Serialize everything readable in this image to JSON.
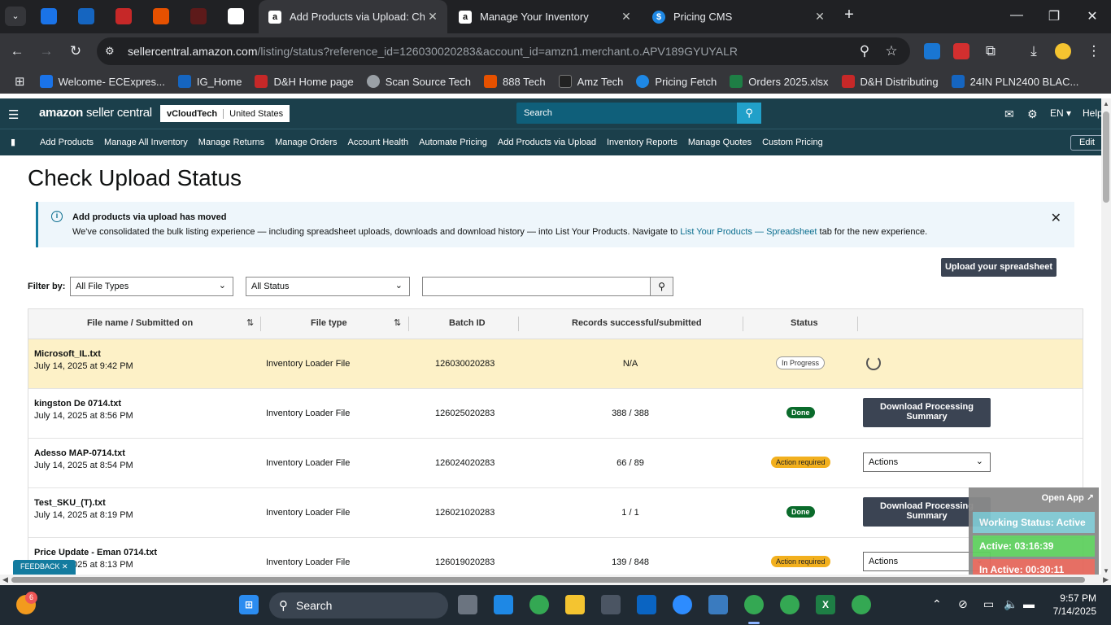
{
  "browser": {
    "tabs": [
      {
        "title": "Add Products via Upload: Check",
        "active": true
      },
      {
        "title": "Manage Your Inventory",
        "active": false
      },
      {
        "title": "Pricing CMS",
        "active": false
      }
    ],
    "url_host": "sellercentral.amazon.com",
    "url_path": "/listing/status?reference_id=126030020283&account_id=amzn1.merchant.o.APV189GYUYALR",
    "bookmarks": [
      {
        "label": "Welcome- ECExpres...",
        "color": "#1a73e8"
      },
      {
        "label": "IG_Home",
        "color": "#1565c0"
      },
      {
        "label": "D&H Home page",
        "color": "#c62828"
      },
      {
        "label": "Scan Source Tech",
        "color": "#9aa0a6"
      },
      {
        "label": "888 Tech",
        "color": "#e65100"
      },
      {
        "label": "Amz Tech",
        "color": "#222222"
      },
      {
        "label": "Pricing Fetch",
        "color": "#1e88e5"
      },
      {
        "label": "Orders 2025.xlsx",
        "color": "#1e7e45"
      },
      {
        "label": "D&H Distributing",
        "color": "#c62828"
      },
      {
        "label": "24IN PLN2400 BLAC...",
        "color": "#1565c0"
      }
    ]
  },
  "seller": {
    "logo_main": "amazon",
    "logo_sub": "seller central",
    "store": "vCloudTech",
    "marketplace": "United States",
    "search_placeholder": "Search",
    "lang": "EN",
    "help": "Help",
    "nav": [
      "Add Products",
      "Manage All Inventory",
      "Manage Returns",
      "Manage Orders",
      "Account Health",
      "Automate Pricing",
      "Add Products via Upload",
      "Inventory Reports",
      "Manage Quotes",
      "Custom Pricing"
    ],
    "edit": "Edit"
  },
  "page": {
    "title": "Check Upload Status",
    "banner_title": "Add products via upload has moved",
    "banner_text_1": "We've consolidated the bulk listing experience — including spreadsheet uploads, downloads and download history — into List Your Products. Navigate to ",
    "banner_link": "List Your Products — Spreadsheet",
    "banner_text_2": " tab for the new experience.",
    "upload_button": "Upload your spreadsheet",
    "filter_label": "Filter by:",
    "filter_type": "All File Types",
    "filter_status": "All Status",
    "search_value": ""
  },
  "table": {
    "headers": [
      "File name / Submitted on",
      "File type",
      "Batch ID",
      "Records successful/submitted",
      "Status"
    ],
    "rows": [
      {
        "name": "Microsoft_IL.txt",
        "date": "July 14, 2025 at 9:42 PM",
        "type": "Inventory Loader File",
        "batch": "126030020283",
        "records": "N/A",
        "status": "In Progress",
        "kind": "progress"
      },
      {
        "name": "kingston De 0714.txt",
        "date": "July 14, 2025 at 8:56 PM",
        "type": "Inventory Loader File",
        "batch": "126025020283",
        "records": "388 / 388",
        "status": "Done",
        "kind": "done"
      },
      {
        "name": "Adesso MAP-0714.txt",
        "date": "July 14, 2025 at 8:54 PM",
        "type": "Inventory Loader File",
        "batch": "126024020283",
        "records": "66 / 89",
        "status": "Action required",
        "kind": "action"
      },
      {
        "name": "Test_SKU_(T).txt",
        "date": "July 14, 2025 at 8:19 PM",
        "type": "Inventory Loader File",
        "batch": "126021020283",
        "records": "1 / 1",
        "status": "Done",
        "kind": "done"
      },
      {
        "name": "Price Update - Eman 0714.txt",
        "date": "July 14, 2025 at 8:13 PM",
        "type": "Inventory Loader File",
        "batch": "126019020283",
        "records": "139 / 848",
        "status": "Action required",
        "kind": "action"
      }
    ],
    "download_label": "Download Processing Summary",
    "actions_label": "Actions"
  },
  "feedback": "FEEDBACK",
  "widget": {
    "open_app": "Open App ↗",
    "status": "Working Status: Active",
    "active": "Active: 03:16:39",
    "inactive": "In Active: 00:30:11"
  },
  "taskbar": {
    "search": "Search",
    "time": "9:57 PM",
    "date": "7/14/2025",
    "badge": "6"
  }
}
